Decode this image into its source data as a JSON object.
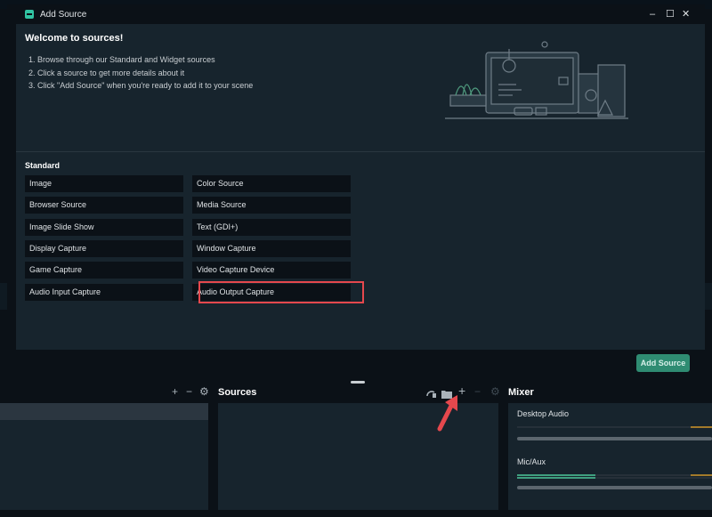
{
  "dialog": {
    "title": "Add Source",
    "window_controls": {
      "minimize": "–",
      "maximize": "☐",
      "close": "✕"
    },
    "welcome_title": "Welcome to sources!",
    "steps": [
      "1. Browse through our Standard and Widget sources",
      "2. Click a source to get more details about it",
      "3. Click \"Add Source\" when you're ready to add it to your scene"
    ],
    "section_label": "Standard",
    "sources": [
      "Image",
      "Color Source",
      "Browser Source",
      "Media Source",
      "Image Slide Show",
      "Text (GDI+)",
      "Display Capture",
      "Window Capture",
      "Game Capture",
      "Video Capture Device",
      "Audio Input Capture",
      "Audio Output Capture"
    ],
    "highlighted_source": "Audio Output Capture",
    "add_button": "Add Source"
  },
  "bottom": {
    "scene_controls": {
      "add": "+",
      "remove": "−",
      "settings": "⚙"
    },
    "sources_title": "Sources",
    "sources_controls": {
      "add": "+",
      "remove": "−",
      "settings": "⚙"
    },
    "mixer_title": "Mixer",
    "mixer_channels": [
      {
        "name": "Desktop Audio",
        "level": 0.0
      },
      {
        "name": "Mic/Aux",
        "level": 0.4
      }
    ]
  },
  "colors": {
    "accent": "#31c3a2",
    "highlight": "#e5484d",
    "button": "#2f8c72"
  }
}
